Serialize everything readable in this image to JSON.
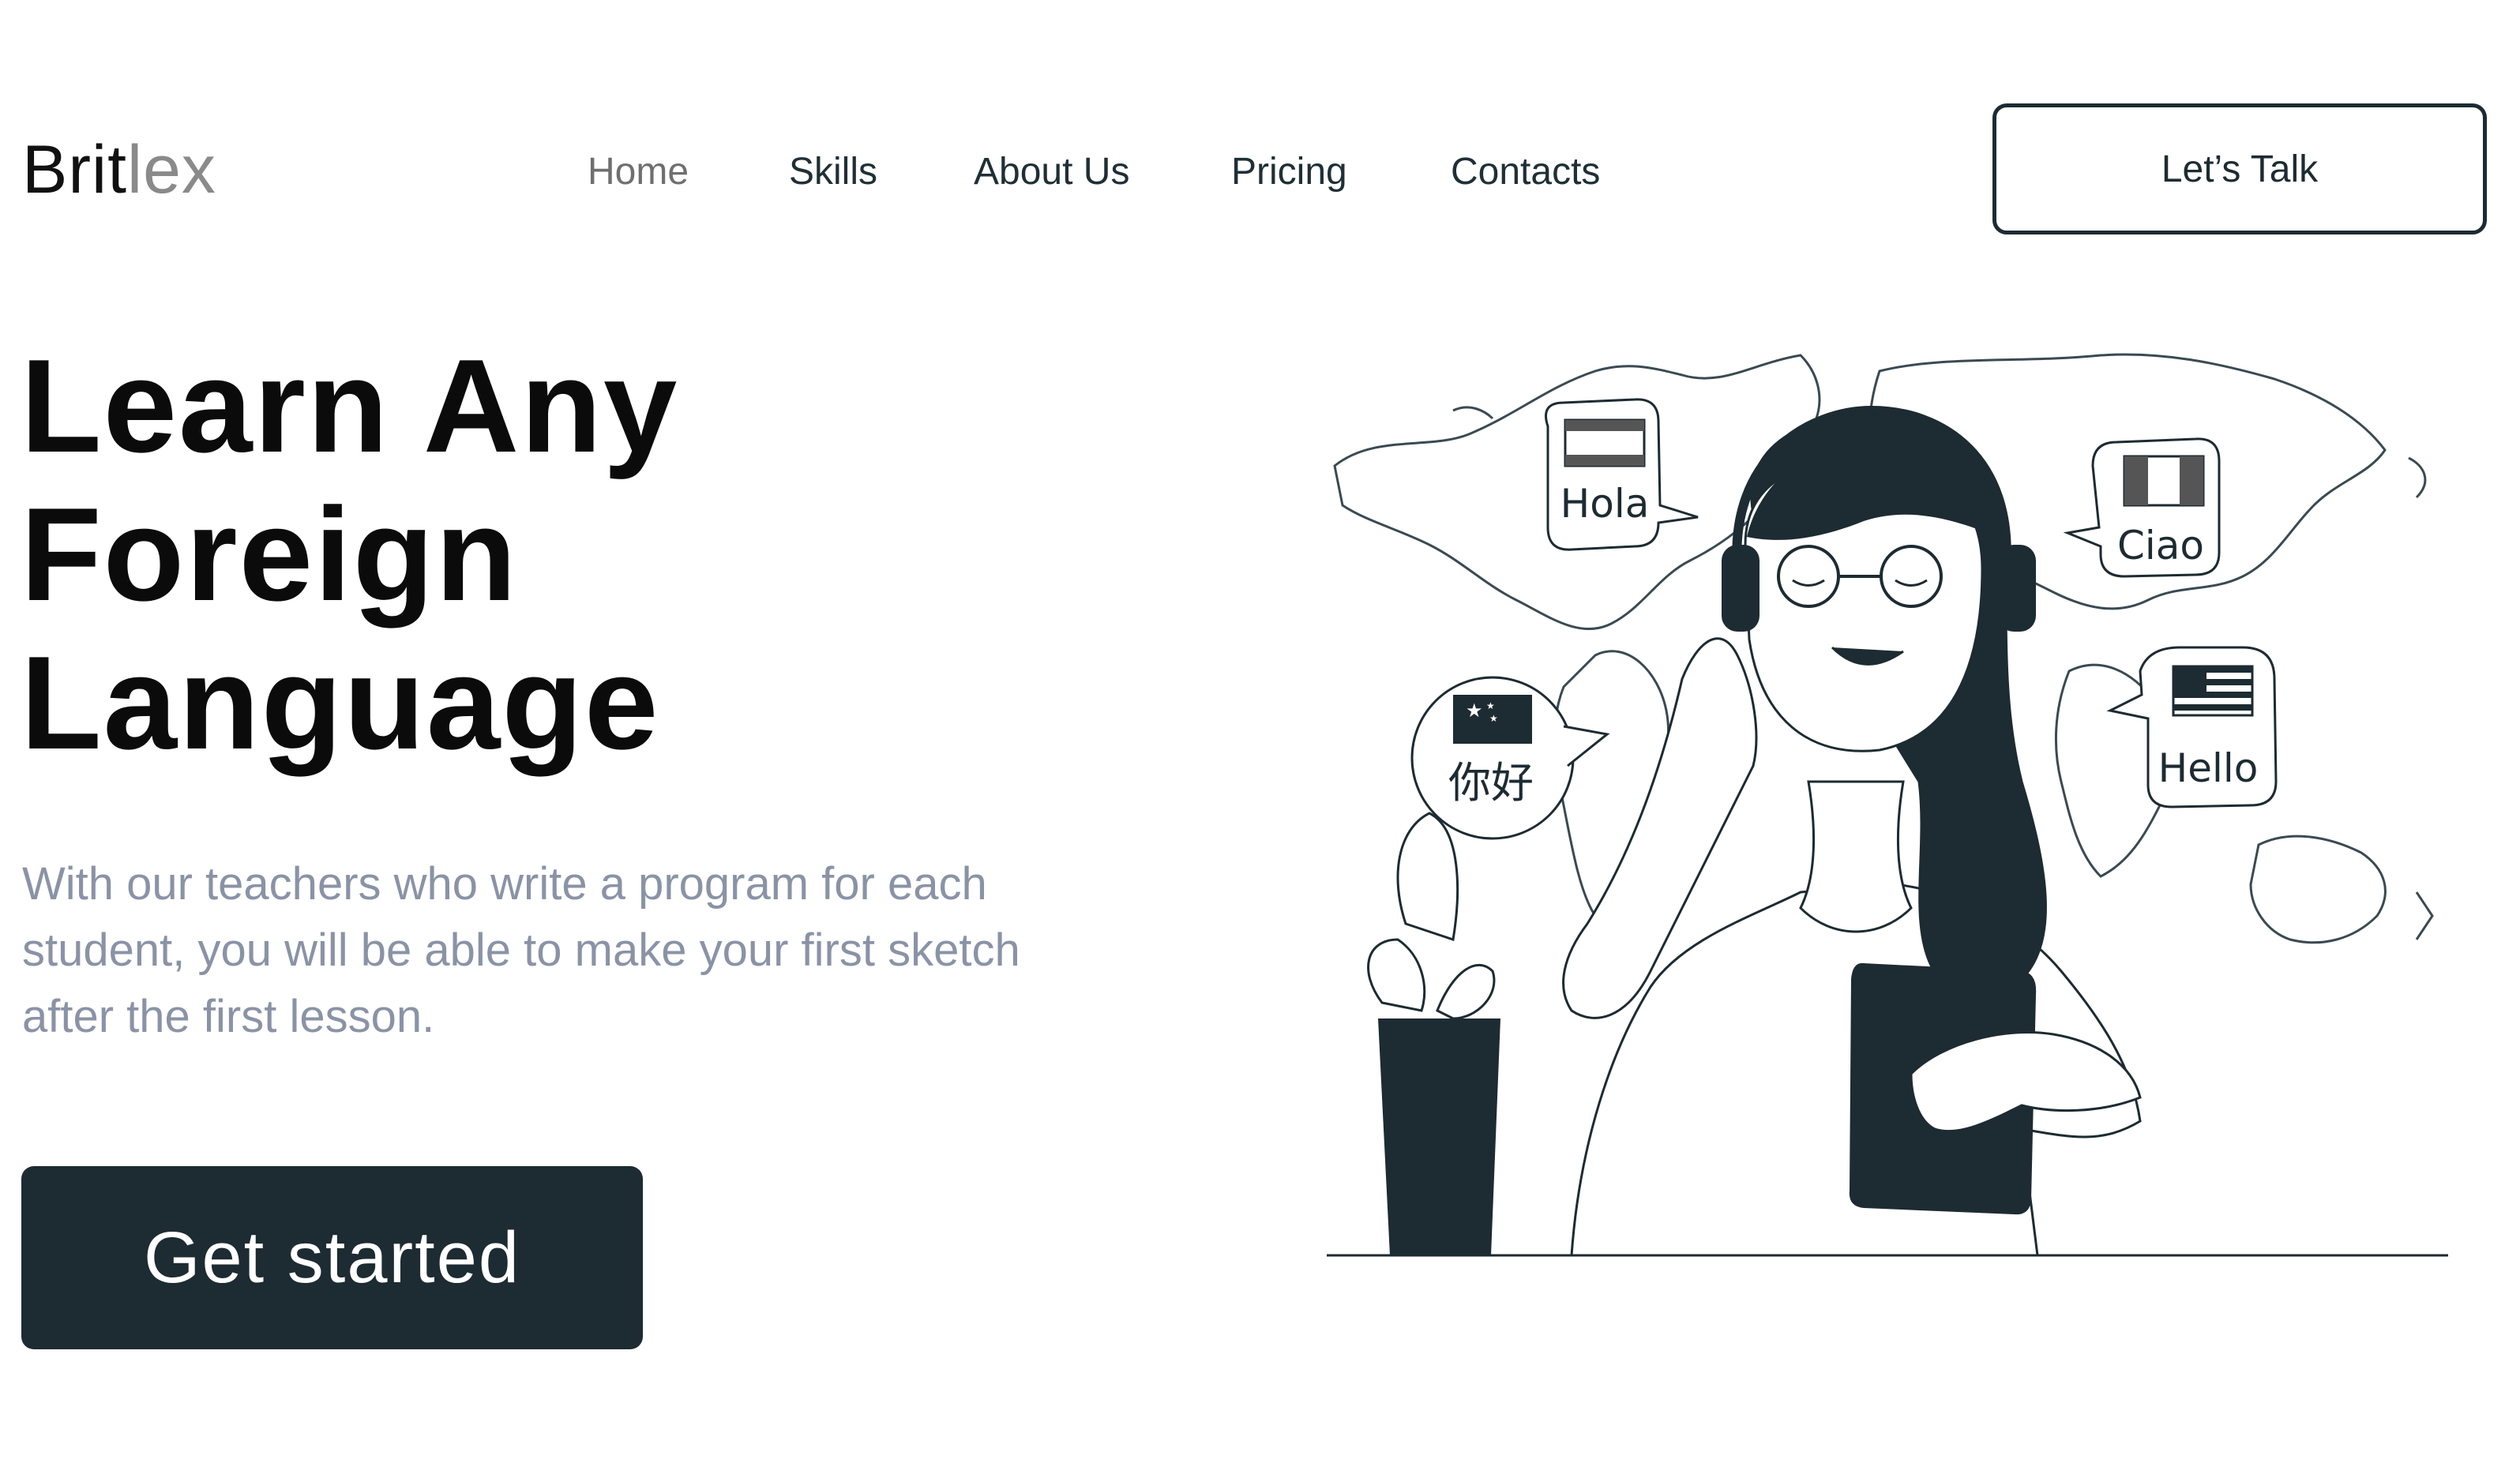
{
  "brand": {
    "part1": "Brit",
    "part2": "lex"
  },
  "nav": {
    "items": [
      {
        "label": "Home",
        "active": true
      },
      {
        "label": "Skills"
      },
      {
        "label": "About Us"
      },
      {
        "label": "Pricing"
      },
      {
        "label": "Contacts"
      }
    ],
    "cta_label": "Let’s Talk"
  },
  "hero": {
    "title_lines": [
      "Learn Any",
      "Foreign",
      "Language"
    ],
    "subtitle": "With our teachers who write a program for each student, you will be able to make your first sketch after the first lesson.",
    "button_label": "Get started"
  },
  "illustration": {
    "greetings": [
      "Hola",
      "Ciao",
      "你好",
      "Hello"
    ],
    "icons": [
      "world-map",
      "headphones",
      "spain-flag",
      "italy-flag",
      "china-flag",
      "usa-flag",
      "tablet",
      "potted-plant"
    ]
  },
  "colors": {
    "primary_dark": "#1d2b32",
    "muted_text": "#8a93a6",
    "logo_accent": "#8a8a8a"
  }
}
